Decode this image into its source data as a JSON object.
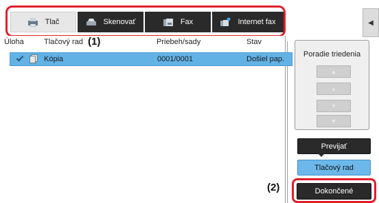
{
  "tabs": [
    {
      "label": "Tlač",
      "icon": "printer-icon",
      "active": true
    },
    {
      "label": "Skenovať",
      "icon": "scanner-icon",
      "active": false
    },
    {
      "label": "Fax",
      "icon": "fax-icon",
      "active": false
    },
    {
      "label": "Internet fax",
      "icon": "internet-fax-icon",
      "active": false
    }
  ],
  "columns": {
    "task": "Úloha",
    "queue": "Tlačový rad",
    "progress": "Priebeh/sady",
    "status": "Stav"
  },
  "jobs": [
    {
      "name": "Kópia",
      "progress": "0001/0001",
      "status": "Došiel pap.",
      "icon": "copy-job-icon",
      "selected": true
    }
  ],
  "sort_panel": {
    "title": "Poradie triedenia",
    "buttons": [
      "move-top-icon",
      "move-up-icon",
      "move-down-icon",
      "move-bottom-icon"
    ]
  },
  "buttons": {
    "spool": "Previjať",
    "print_queue": "Tlačový rad",
    "finished": "Dokončené"
  },
  "callouts": {
    "one": "(1)",
    "two": "(2)"
  },
  "colors": {
    "highlight_frame": "#e01e2b",
    "selected_row": "#63b2e6",
    "active_button": "#6cb8ea",
    "dark_button": "#2a2a2a"
  }
}
